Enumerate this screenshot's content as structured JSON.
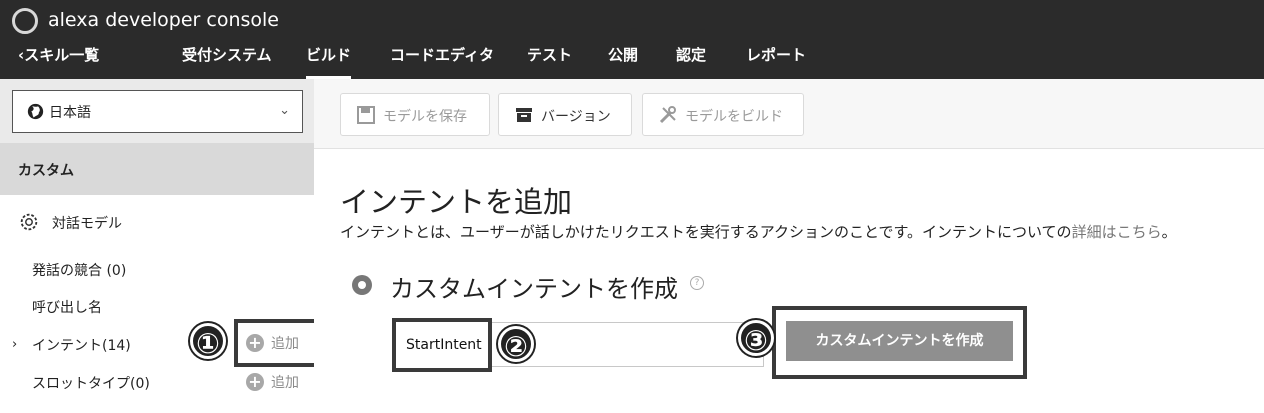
{
  "header": {
    "app_title": "alexa developer console",
    "back_label": "スキル一覧",
    "tabs": [
      {
        "label": "受付システム"
      },
      {
        "label": "ビルド"
      },
      {
        "label": "コードエディタ"
      },
      {
        "label": "テスト"
      },
      {
        "label": "公開"
      },
      {
        "label": "認定"
      },
      {
        "label": "レポート"
      }
    ],
    "active_tab": "ビルド"
  },
  "sidebar": {
    "language": "日本語",
    "section": "カスタム",
    "dialog_model": "対話モデル",
    "items": [
      {
        "label": "発話の競合 (0)"
      },
      {
        "label": "呼び出し名"
      },
      {
        "label": "インテント(14)"
      },
      {
        "label": "スロットタイプ(0)"
      }
    ],
    "add_label": "追加"
  },
  "toolbar": {
    "save_label": "モデルを保存",
    "version_label": "バージョン",
    "build_label": "モデルをビルド"
  },
  "main": {
    "title": "インテントを追加",
    "description": "インテントとは、ユーザーが話しかけたリクエストを実行するアクションのことです。インテントについての",
    "link_text": "詳細はこちら",
    "description_end": "。",
    "section_title": "カスタムインテントを作成",
    "help": "?",
    "intent_value": "StartIntent",
    "create_button": "カスタムインテントを作成"
  },
  "annotations": {
    "step1": "①",
    "step2": "②",
    "step3": "③"
  },
  "colors": {
    "header_bg": "#2b2b2b",
    "primary_button": "#8f8f8f",
    "highlight": "#3a3a3a"
  }
}
